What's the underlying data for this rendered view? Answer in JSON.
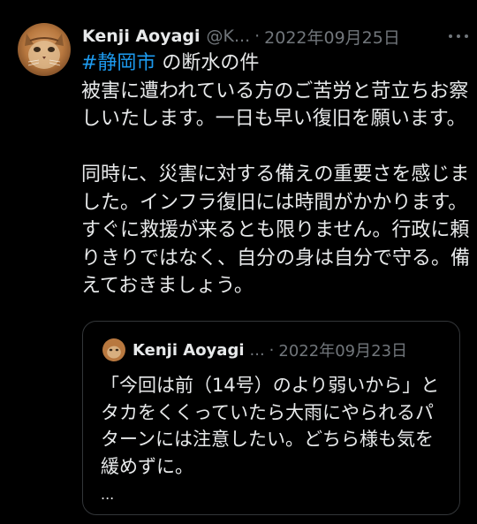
{
  "tweet": {
    "author_name": "Kenji Aoyagi",
    "author_handle": "@K...",
    "separator": "·",
    "date": "2022年09月25日",
    "hashtag": "#静岡市",
    "first_line_rest": " の断水の件",
    "body": "被害に遭われている方のご苦労と苛立ちお察しいたします。一日も早い復旧を願います。\n\n同時に、災害に対する備えの重要さを感じました。インフラ復旧には時間がかかります。すぐに救援が来るとも限りません。行政に頼りきりではなく、自分の身は自分で守る。備えておきましょう。",
    "more_icon": "more-horizontal-icon",
    "accent_color": "#1d9bf0"
  },
  "quote": {
    "author_name": "Kenji Aoyagi",
    "name_ellipsis": "...",
    "separator": "·",
    "date": "2022年09月23日",
    "text": "「今回は前（14号）のより弱いから」とタカをくくっていたら大雨にやられるパターンには注意したい。どちら様も気を緩めずに。",
    "truncation": "..."
  }
}
